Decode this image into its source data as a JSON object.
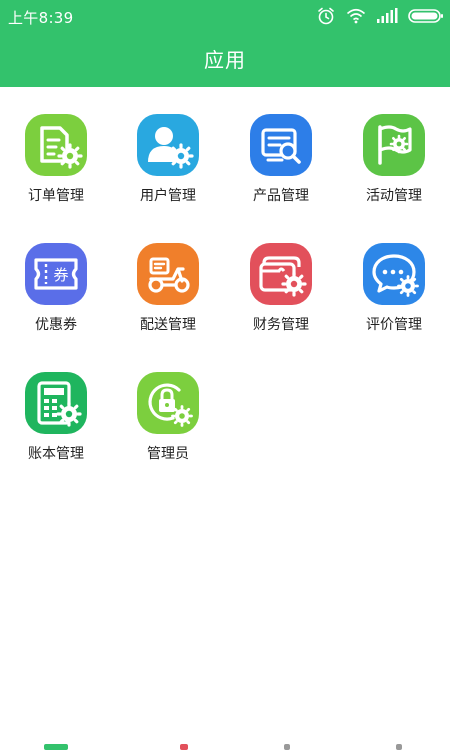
{
  "status": {
    "time": "上午8:39",
    "icons": [
      "alarm-icon",
      "wifi-icon",
      "signal-icon",
      "battery-icon"
    ]
  },
  "header": {
    "title": "应用"
  },
  "colors": {
    "header_bg": "#33c26c",
    "label_text": "#222222"
  },
  "apps": [
    {
      "label": "订单管理",
      "icon": "order-document-gear-icon",
      "color": "#7ccf3e"
    },
    {
      "label": "用户管理",
      "icon": "user-gear-icon",
      "color": "#29a8e0"
    },
    {
      "label": "产品管理",
      "icon": "product-search-icon",
      "color": "#2d7ee8"
    },
    {
      "label": "活动管理",
      "icon": "flag-gear-icon",
      "color": "#5cc446"
    },
    {
      "label": "优惠券",
      "icon": "coupon-ticket-icon",
      "color": "#5a6ee8",
      "ticket_text": "券"
    },
    {
      "label": "配送管理",
      "icon": "delivery-scooter-icon",
      "color": "#f07f2b"
    },
    {
      "label": "财务管理",
      "icon": "wallet-gear-icon",
      "color": "#e2505b"
    },
    {
      "label": "评价管理",
      "icon": "chat-bubble-gear-icon",
      "color": "#2d87e8"
    },
    {
      "label": "账本管理",
      "icon": "ledger-calculator-gear-icon",
      "color": "#1fb55e"
    },
    {
      "label": "管理员",
      "icon": "admin-lock-gear-icon",
      "color": "#7ccf3e"
    }
  ]
}
